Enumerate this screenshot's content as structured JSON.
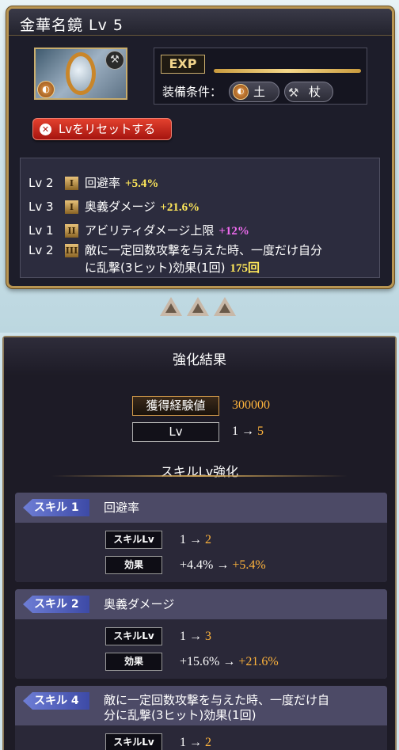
{
  "item": {
    "title": "金華名鏡 Lv 5",
    "exp_label": "EXP",
    "equip_label": "装備条件：",
    "element_icon": "earth-element-icon",
    "element_label": "土",
    "weapon_icon": "staff-icon",
    "weapon_label": "杖",
    "reset_label": "Lvをリセットする",
    "skills": [
      {
        "level": "Lv 2",
        "tier": "I",
        "name": "回避率",
        "value": "+5.4%"
      },
      {
        "level": "Lv 3",
        "tier": "I",
        "name": "奥義ダメージ",
        "value": "+21.6%"
      },
      {
        "level": "Lv 1",
        "tier": "II",
        "name": "アビリティダメージ上限",
        "value": "+12%"
      },
      {
        "level": "Lv 2",
        "tier": "III",
        "name": "敵に一定回数攻撃を与えた時、一度だけ自分",
        "name2": "に乱撃(3ヒット)効果(1回)",
        "value": "175回"
      }
    ]
  },
  "result": {
    "title": "強化結果",
    "exp_gained_label": "獲得経験値",
    "exp_gained_value": "300000",
    "lv_label": "Lv",
    "lv_from": "1 →",
    "lv_to": "5",
    "section_title": "スキルLv強化",
    "skill_lv_label": "スキルLv",
    "effect_label": "効果",
    "cards": [
      {
        "tag": "スキル 1",
        "name": "回避率",
        "lv_from": "1 →",
        "lv_to": "2",
        "eff_from": "+4.4% →",
        "eff_to": "+5.4%"
      },
      {
        "tag": "スキル 2",
        "name": "奥義ダメージ",
        "lv_from": "1 →",
        "lv_to": "3",
        "eff_from": "+15.6% →",
        "eff_to": "+21.6%"
      },
      {
        "tag": "スキル 4",
        "name": "敵に一定回数攻撃を与えた時、一度だけ自",
        "name2": "分に乱撃(3ヒット)効果(1回)",
        "lv_from": "1 →",
        "lv_to": "2"
      }
    ]
  },
  "colors": {
    "gold": "#ffb43c",
    "yellow": "#ffe85a",
    "purple": "#f06cf0",
    "reset_red": "#c4261c"
  }
}
